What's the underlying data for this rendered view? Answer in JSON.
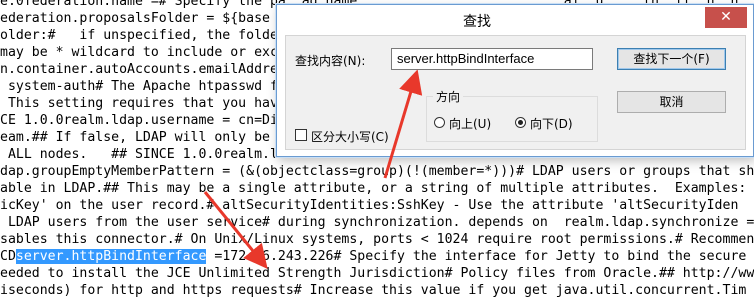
{
  "editor": {
    "lines": [
      "e.0federation.name =# Specify the pa  ad name                          ai  u  .  th  ff  n  n",
      "ederation.proposalsFolder = ${base                                              ",
      "older:#   if unspecified, the folder                                          ecur",
      "may be * wildcard to include or exc                                           gear",
      "n.container.autoAccounts.emailAddre                                           alue",
      " system-auth# The Apache htpasswd f                                           leee",
      " This setting requires that you hav                                           #CD",
      "CE 1.0.0realm.ldap.username = cn=Di                                           ##",
      "eam.## If false, LDAP will only be                                            ect",
      " ALL nodes.   ## SINCE 1.0.0realm.ld                                          DC",
      "dap.groupEmptyMemberPattern = (&(objectclass=group)(!(member=*)))# LDAP users or groups that sh",
      "able in LDAP.## This may be a single attribute, or a string of multiple attributes.  Examples:",
      "icKey' on the user record.# altSecurityIdentities:SshKey - Use the attribute 'altSecurityIden",
      " LDAP users from the user service# during synchronization. depends on  realm.ldap.synchronize =",
      "sables this connector.# On Unix/Linux systems, ports < 1024 require root permissions.# Recommen"
    ],
    "line15_prefix": "CD",
    "line15_highlight": "server.httpBindInterface",
    "line15_rest": " =172.16.243.226# Specify the interface for Jetty to bind the secure",
    "line16": "eeded to install the JCE Unlimited Strength Jurisdiction# Policy files from Oracle.## http://www.",
    "line17": "iseconds) for http and https requests# Increase this value if you get java.util.concurrent.Tim"
  },
  "dialog": {
    "title": "查找",
    "close_glyph": "✕",
    "find_label": "查找内容(N):",
    "find_value": "server.httpBindInterface",
    "find_next_label": "查找下一个(F)",
    "cancel_label": "取消",
    "direction_label": "方向",
    "up_label": "向上(U)",
    "down_label": "向下(D)",
    "selected_direction": "down",
    "match_case_label": "区分大小写(C)",
    "match_case_checked": false
  },
  "colors": {
    "highlight": "#3399ff",
    "annotation_arrow": "#e8382b",
    "close_button": "#c7504b"
  }
}
